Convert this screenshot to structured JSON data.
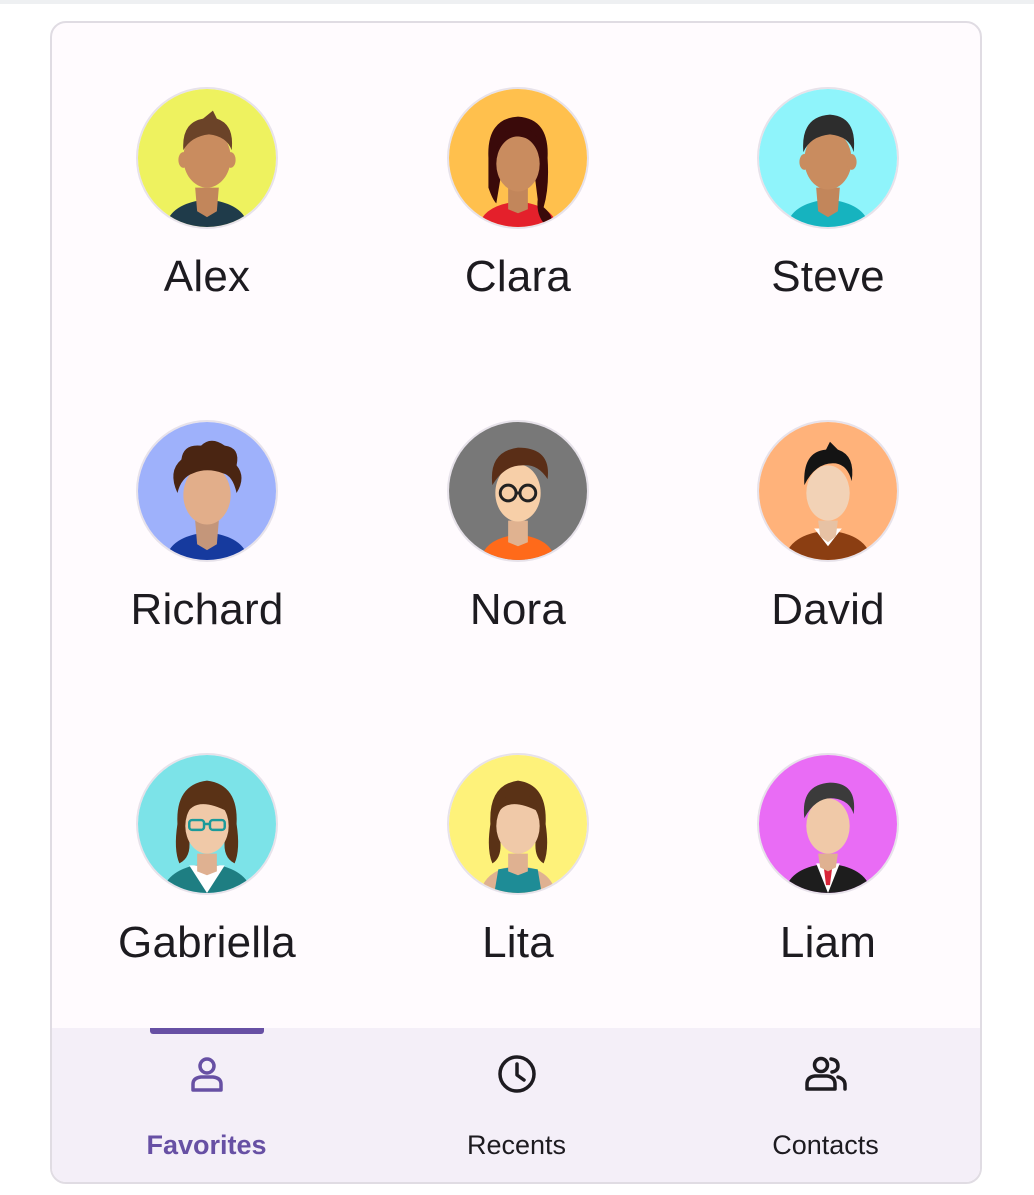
{
  "favorites": {
    "people": [
      {
        "name": "Alex",
        "avatar_bg": "#eef25f"
      },
      {
        "name": "Clara",
        "avatar_bg": "#ffc04d"
      },
      {
        "name": "Steve",
        "avatar_bg": "#8ff4fb"
      },
      {
        "name": "Richard",
        "avatar_bg": "#9eb1fb"
      },
      {
        "name": "Nora",
        "avatar_bg": "#787878"
      },
      {
        "name": "David",
        "avatar_bg": "#ffb27a"
      },
      {
        "name": "Gabriella",
        "avatar_bg": "#7ce3e8"
      },
      {
        "name": "Lita",
        "avatar_bg": "#fef27a"
      },
      {
        "name": "Liam",
        "avatar_bg": "#e96cf5"
      }
    ]
  },
  "nav": {
    "items": [
      {
        "label": "Favorites",
        "icon": "person-icon",
        "active": true
      },
      {
        "label": "Recents",
        "icon": "clock-icon",
        "active": false
      },
      {
        "label": "Contacts",
        "icon": "group-icon",
        "active": false
      }
    ]
  },
  "colors": {
    "accent": "#6750a4",
    "surface": "#fffbfe",
    "nav_bg": "#f4eff8",
    "text": "#1d1b20"
  }
}
